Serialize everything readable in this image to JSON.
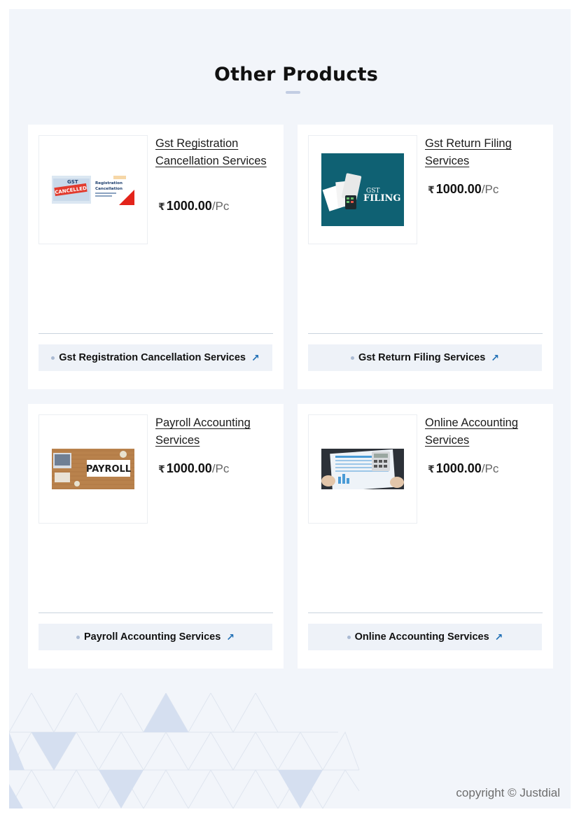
{
  "section": {
    "title": "Other Products"
  },
  "products": [
    {
      "name": "Gst Registration Cancellation Services",
      "rupee": "₹",
      "price": "1000.00",
      "unit": "/Pc",
      "category": "Gst Registration Cancellation Services",
      "image_icon": "gst-cancellation-image",
      "image_text": [
        "GST",
        "Registration",
        "Cancellation",
        "CANCELLED"
      ]
    },
    {
      "name": "Gst Return Filing Services",
      "rupee": "₹",
      "price": "1000.00",
      "unit": "/Pc",
      "category": "Gst Return Filing Services",
      "image_icon": "gst-filing-image",
      "image_text": [
        "GST",
        "FILING"
      ]
    },
    {
      "name": "Payroll Accounting Services",
      "rupee": "₹",
      "price": "1000.00",
      "unit": "/Pc",
      "category": "Payroll Accounting Services",
      "image_icon": "payroll-image",
      "image_text": [
        "PAYROLL"
      ]
    },
    {
      "name": "Online Accounting Services",
      "rupee": "₹",
      "price": "1000.00",
      "unit": "/Pc",
      "category": "Online Accounting Services",
      "image_icon": "accounting-image",
      "image_text": []
    }
  ],
  "footer": {
    "copyright": "copyright © Justdial"
  },
  "colors": {
    "page_bg": "#f2f5fa",
    "accent": "#1f6fb5",
    "button_bg": "#eef2f8"
  }
}
